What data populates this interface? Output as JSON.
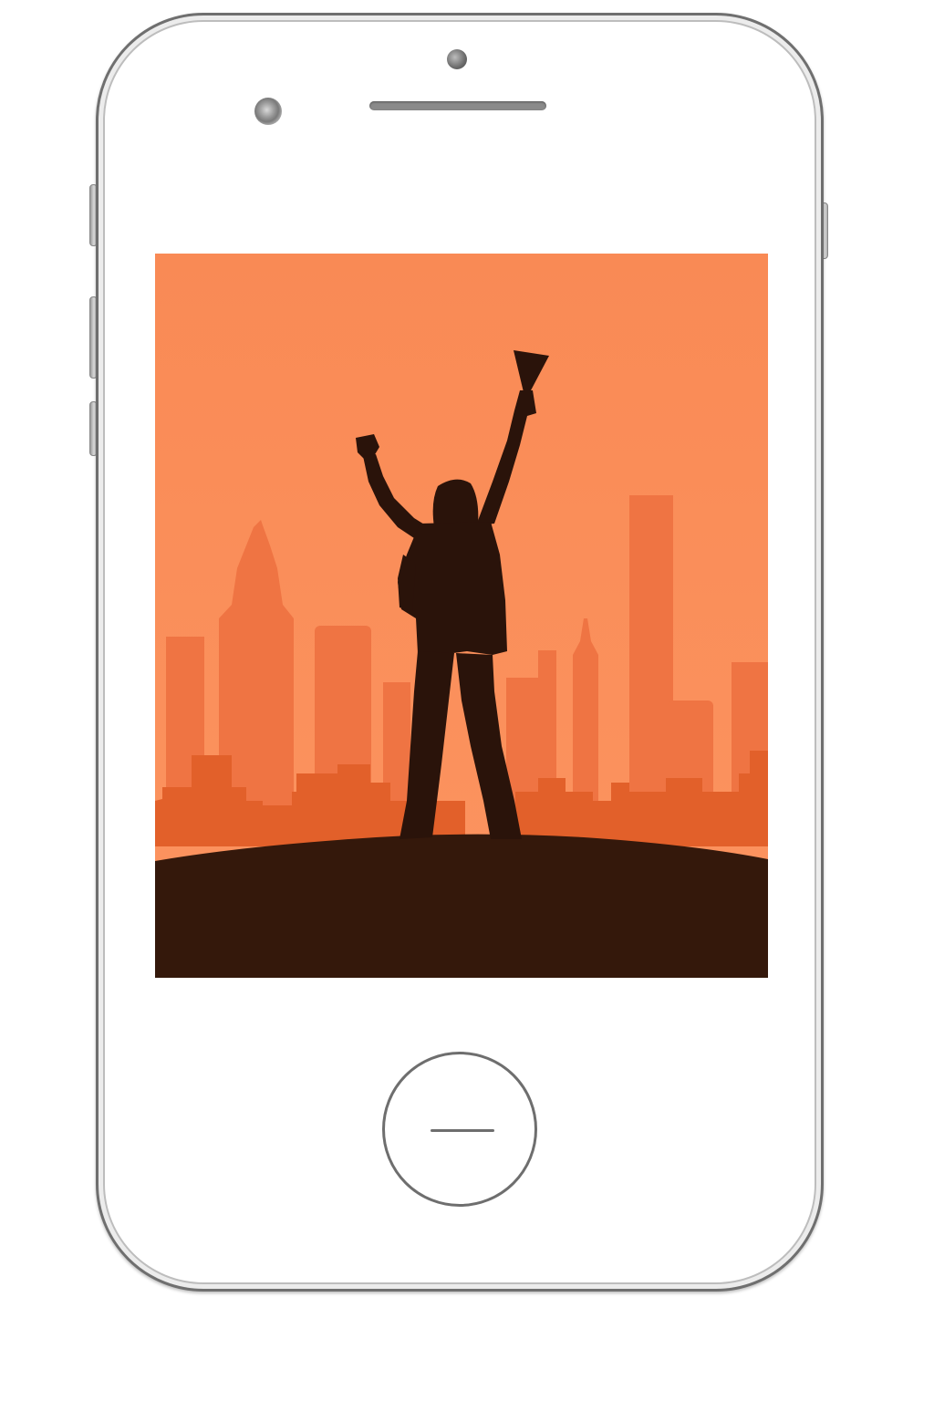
{
  "device": {
    "type": "smartphone",
    "frame_color": "#ffffff",
    "outline_color": "#6f6f6f"
  },
  "screen": {
    "illustration": "silhouette-celebrating-over-city-skyline",
    "colors": {
      "sky": "#fb8d58",
      "sky_top": "#f98a55",
      "buildings_back": "#ef7443",
      "buildings_front": "#e2602a",
      "ground": "#34180b",
      "figure": "#2a130a"
    }
  },
  "icons": {
    "home": "home-button-icon",
    "camera": "front-camera-icon",
    "sensor": "proximity-sensor-icon",
    "speaker": "earpiece-speaker-icon"
  }
}
